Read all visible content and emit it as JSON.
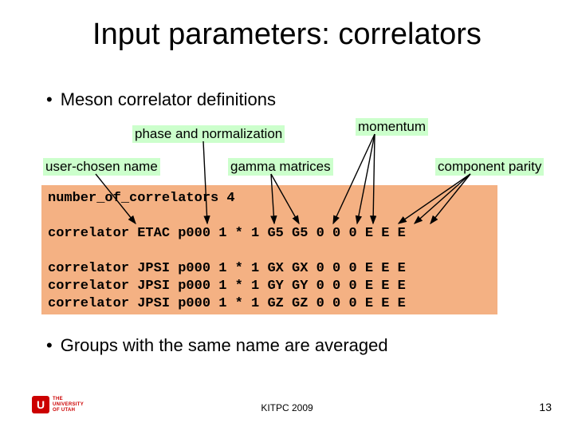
{
  "title": "Input parameters: correlators",
  "bullet_meson": "Meson correlator definitions",
  "labels": {
    "phase": "phase and normalization",
    "momentum": "momentum",
    "user": "user-chosen name",
    "gamma": "gamma matrices",
    "parity": "component parity"
  },
  "code": "number_of_correlators 4\n\ncorrelator ETAC p000 1 * 1 G5 G5 0 0 0 E E E\n\ncorrelator JPSI p000 1 * 1 GX GX 0 0 0 E E E\ncorrelator JPSI p000 1 * 1 GY GY 0 0 0 E E E\ncorrelator JPSI p000 1 * 1 GZ GZ 0 0 0 E E E",
  "bullet_groups": "Groups with the same name are averaged",
  "footer": {
    "center": "KITPC 2009",
    "page": "13",
    "logo_line1": "THE",
    "logo_line2": "UNIVERSITY",
    "logo_line3": "OF UTAH"
  }
}
